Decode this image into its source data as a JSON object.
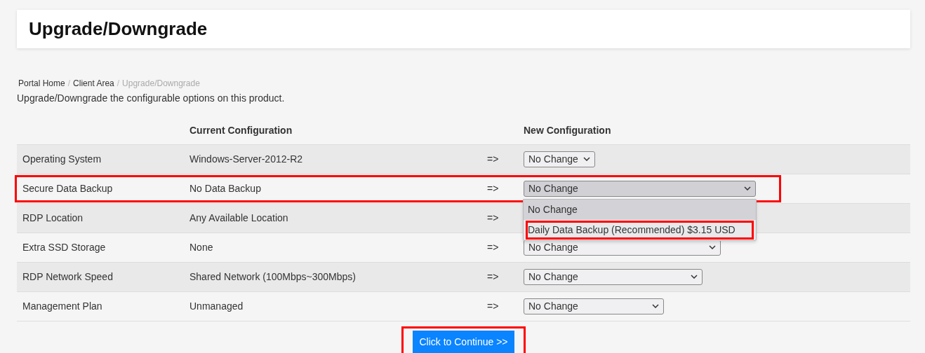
{
  "page_title": "Upgrade/Downgrade",
  "breadcrumb": [
    {
      "label": "Portal Home",
      "current": false
    },
    {
      "label": "Client Area",
      "current": false,
      "separator": "/"
    },
    {
      "label": "Upgrade/Downgrade",
      "current": true,
      "separator": "/"
    }
  ],
  "description": "Upgrade/Downgrade the configurable options on this product.",
  "table": {
    "columns": [
      "Current Configuration",
      "New Configuration"
    ],
    "rows": [
      {
        "option": "Operating System",
        "current": "Windows-Server-2012-R2",
        "arrow": "=>",
        "new_value": "No Change",
        "highlighted": false
      },
      {
        "option": "Secure Data Backup",
        "current": "No Data Backup",
        "arrow": "=>",
        "new_value": "No Change",
        "highlighted": true,
        "open": true,
        "menu": [
          {
            "label": "No Change",
            "selected": true,
            "highlighted": false
          },
          {
            "label": "Daily Data Backup (Recommended) $3.15 USD",
            "selected": false,
            "highlighted": true
          }
        ]
      },
      {
        "option": "RDP Location",
        "current": "Any Available Location",
        "arrow": "=>",
        "highlighted": false
      },
      {
        "option": "Extra SSD Storage",
        "current": "None",
        "arrow": "=>",
        "new_value": "No Change",
        "highlighted": false
      },
      {
        "option": "RDP Network Speed",
        "current": "Shared Network (100Mbps~300Mbps)",
        "arrow": "=>",
        "new_value": "No Change",
        "highlighted": false
      },
      {
        "option": "Management Plan",
        "current": "Unmanaged",
        "arrow": "=>",
        "new_value": "No Change",
        "highlighted": false
      }
    ]
  },
  "continue_button": {
    "label": "Click to Continue >>",
    "highlighted": true
  }
}
